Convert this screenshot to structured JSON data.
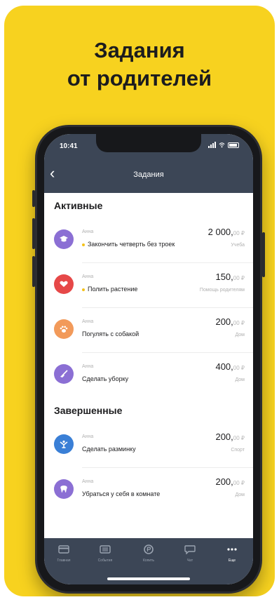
{
  "headline": {
    "line1": "Задания",
    "line2": "от родителей"
  },
  "status_bar": {
    "time": "10:41"
  },
  "nav": {
    "back_icon": "chevron-left-icon",
    "title": "Задания"
  },
  "sections": {
    "active": {
      "title": "Активные",
      "items": [
        {
          "who": "Анна",
          "title": "Закончить четверть без троек",
          "amount": "2 000,",
          "cents": "00 ₽",
          "category": "Учеба",
          "icon": "graduation-cap-icon",
          "color": "#8b6fd4",
          "pending": true
        },
        {
          "who": "Анна",
          "title": "Полить растение",
          "amount": "150,",
          "cents": "00 ₽",
          "category": "Помощь родителям",
          "icon": "heart-hand-icon",
          "color": "#e64848",
          "pending": true
        },
        {
          "who": "Анна",
          "title": "Погулять с собакой",
          "amount": "200,",
          "cents": "00 ₽",
          "category": "Дом",
          "icon": "paw-icon",
          "color": "#f29a5a",
          "pending": false
        },
        {
          "who": "Анна",
          "title": "Сделать уборку",
          "amount": "400,",
          "cents": "00 ₽",
          "category": "Дом",
          "icon": "broom-icon",
          "color": "#8b6fd4",
          "pending": false
        }
      ]
    },
    "done": {
      "title": "Завершенные",
      "items": [
        {
          "who": "Анна",
          "title": "Сделать разминку",
          "amount": "200,",
          "cents": "00 ₽",
          "category": "Спорт",
          "icon": "exercise-icon",
          "color": "#3a7fd6",
          "pending": false
        },
        {
          "who": "Анна",
          "title": "Убраться у себя в комнате",
          "amount": "200,",
          "cents": "00 ₽",
          "category": "Дом",
          "icon": "tooth-icon",
          "color": "#8b6fd4",
          "pending": false
        }
      ]
    }
  },
  "tabbar": {
    "items": [
      {
        "label": "Главная",
        "icon": "card-icon"
      },
      {
        "label": "События",
        "icon": "list-icon"
      },
      {
        "label": "Копить",
        "icon": "coin-icon"
      },
      {
        "label": "Чат",
        "icon": "chat-icon"
      },
      {
        "label": "Еще",
        "icon": "more-icon"
      }
    ]
  }
}
